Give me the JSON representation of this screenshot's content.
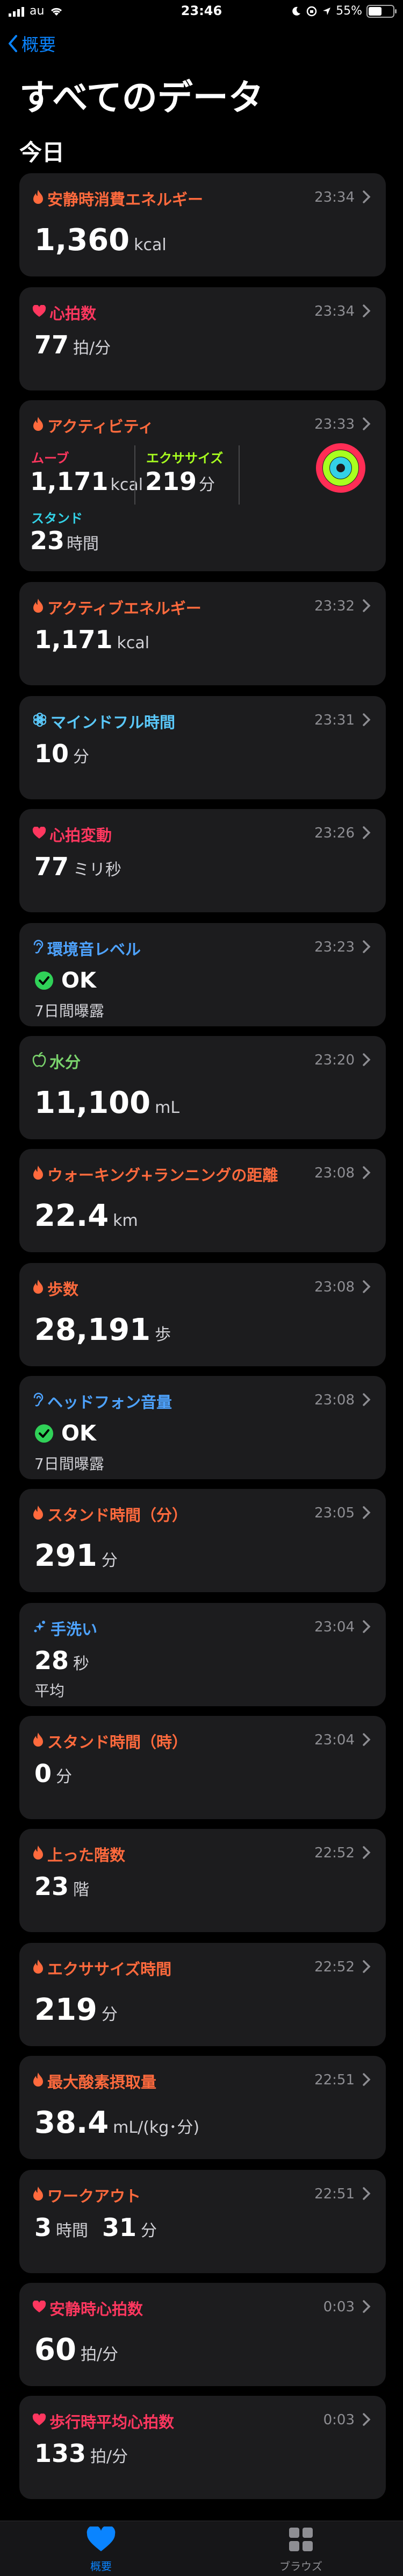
{
  "status_bar": {
    "carrier": "au",
    "time": "23:46",
    "battery": "55%",
    "battery_level": 0.55
  },
  "nav": {
    "back_label": "概要"
  },
  "page": {
    "title": "すべてのデータ",
    "section": "今日"
  },
  "cards": [
    {
      "title": "安静時消費エネルギー",
      "color": "#ff6a3d",
      "icon": "flame-icon",
      "time": "23:34",
      "value": "1,360",
      "unit": "kcal"
    },
    {
      "title": "心拍数",
      "color": "#ff375f",
      "icon": "heart-icon",
      "time": "23:34",
      "value": "77",
      "unit": "拍/分"
    },
    {
      "title": "アクティビティ",
      "color": "#ff6a3d",
      "icon": "flame-icon",
      "time": "23:33",
      "move_label": "ムーブ",
      "move_value": "1,171",
      "move_unit": "kcal",
      "move_color": "#ff375f",
      "exercise_label": "エクササイズ",
      "exercise_value": "219",
      "exercise_unit": "分",
      "exercise_color": "#a8ff1f",
      "stand_label": "スタンド",
      "stand_value": "23",
      "stand_unit": "時間",
      "stand_color": "#33d1e6"
    },
    {
      "title": "アクティブエネルギー",
      "color": "#ff6a3d",
      "icon": "flame-icon",
      "time": "23:32",
      "value": "1,171",
      "unit": "kcal"
    },
    {
      "title": "マインドフル時間",
      "color": "#5ac8fa",
      "icon": "mindful-icon",
      "time": "23:31",
      "value": "10",
      "unit": "分"
    },
    {
      "title": "心拍変動",
      "color": "#ff375f",
      "icon": "heart-icon",
      "time": "23:26",
      "value": "77",
      "unit": "ミリ秒"
    },
    {
      "title": "環境音レベル",
      "color": "#4ea3ff",
      "icon": "ear-icon",
      "time": "23:23",
      "value": "OK",
      "sub": "7日間曝露"
    },
    {
      "title": "水分",
      "color": "#7ad36c",
      "icon": "apple-icon",
      "time": "23:20",
      "value": "11,100",
      "unit": "mL"
    },
    {
      "title": "ウォーキング+ランニングの距離",
      "color": "#ff6a3d",
      "icon": "flame-icon",
      "time": "23:08",
      "value": "22.4",
      "unit": "km"
    },
    {
      "title": "歩数",
      "color": "#ff6a3d",
      "icon": "flame-icon",
      "time": "23:08",
      "value": "28,191",
      "unit": "歩"
    },
    {
      "title": "ヘッドフォン音量",
      "color": "#4ea3ff",
      "icon": "ear-icon",
      "time": "23:08",
      "value": "OK",
      "sub": "7日間曝露"
    },
    {
      "title": "スタンド時間（分）",
      "color": "#ff6a3d",
      "icon": "flame-icon",
      "time": "23:05",
      "value": "291",
      "unit": "分"
    },
    {
      "title": "手洗い",
      "color": "#4ea3ff",
      "icon": "handwash-icon",
      "time": "23:04",
      "value": "28",
      "unit": "秒",
      "sub": "平均"
    },
    {
      "title": "スタンド時間（時）",
      "color": "#ff6a3d",
      "icon": "flame-icon",
      "time": "23:04",
      "value": "0",
      "unit": "分"
    },
    {
      "title": "上った階数",
      "color": "#ff6a3d",
      "icon": "flame-icon",
      "time": "22:52",
      "value": "23",
      "unit": "階"
    },
    {
      "title": "エクササイズ時間",
      "color": "#ff6a3d",
      "icon": "flame-icon",
      "time": "22:52",
      "value": "219",
      "unit": "分"
    },
    {
      "title": "最大酸素摂取量",
      "color": "#ff6a3d",
      "icon": "flame-icon",
      "time": "22:51",
      "value": "38.4",
      "unit": "mL/(kg･分)"
    },
    {
      "title": "ワークアウト",
      "color": "#ff6a3d",
      "icon": "flame-icon",
      "time": "22:51",
      "value": "3",
      "unit": "時間",
      "value2": "31",
      "unit2": "分"
    },
    {
      "title": "安静時心拍数",
      "color": "#ff375f",
      "icon": "heart-icon",
      "time": "0:03",
      "value": "60",
      "unit": "拍/分"
    },
    {
      "title": "歩行時平均心拍数",
      "color": "#ff375f",
      "icon": "heart-icon",
      "time": "0:03",
      "value": "133",
      "unit": "拍/分"
    }
  ],
  "tab_bar": {
    "summary_label": "概要",
    "browse_label": "ブラウズ",
    "active_color": "#0a84ff",
    "inactive_color": "#8e8e93"
  }
}
